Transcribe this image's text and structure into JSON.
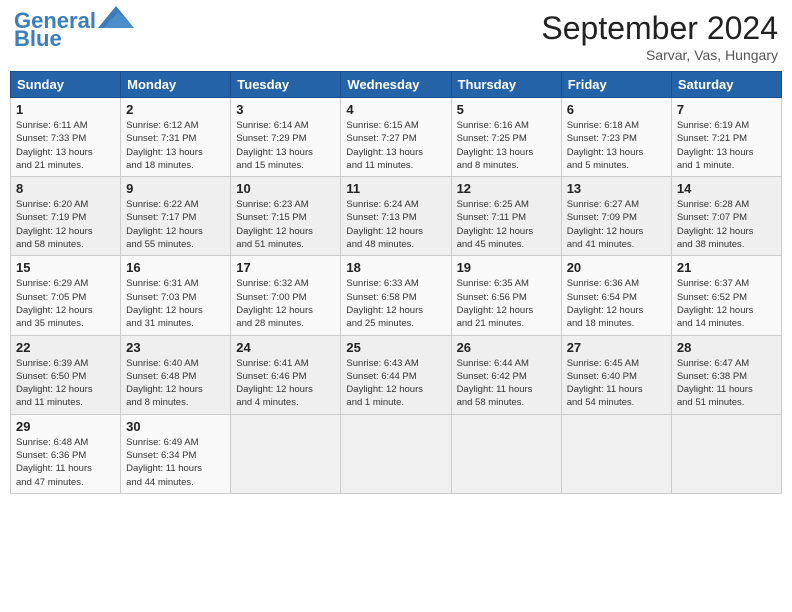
{
  "header": {
    "logo_line1": "General",
    "logo_line2": "Blue",
    "month": "September 2024",
    "location": "Sarvar, Vas, Hungary"
  },
  "days_of_week": [
    "Sunday",
    "Monday",
    "Tuesday",
    "Wednesday",
    "Thursday",
    "Friday",
    "Saturday"
  ],
  "weeks": [
    [
      {
        "day": "1",
        "info": "Sunrise: 6:11 AM\nSunset: 7:33 PM\nDaylight: 13 hours\nand 21 minutes."
      },
      {
        "day": "2",
        "info": "Sunrise: 6:12 AM\nSunset: 7:31 PM\nDaylight: 13 hours\nand 18 minutes."
      },
      {
        "day": "3",
        "info": "Sunrise: 6:14 AM\nSunset: 7:29 PM\nDaylight: 13 hours\nand 15 minutes."
      },
      {
        "day": "4",
        "info": "Sunrise: 6:15 AM\nSunset: 7:27 PM\nDaylight: 13 hours\nand 11 minutes."
      },
      {
        "day": "5",
        "info": "Sunrise: 6:16 AM\nSunset: 7:25 PM\nDaylight: 13 hours\nand 8 minutes."
      },
      {
        "day": "6",
        "info": "Sunrise: 6:18 AM\nSunset: 7:23 PM\nDaylight: 13 hours\nand 5 minutes."
      },
      {
        "day": "7",
        "info": "Sunrise: 6:19 AM\nSunset: 7:21 PM\nDaylight: 13 hours\nand 1 minute."
      }
    ],
    [
      {
        "day": "8",
        "info": "Sunrise: 6:20 AM\nSunset: 7:19 PM\nDaylight: 12 hours\nand 58 minutes."
      },
      {
        "day": "9",
        "info": "Sunrise: 6:22 AM\nSunset: 7:17 PM\nDaylight: 12 hours\nand 55 minutes."
      },
      {
        "day": "10",
        "info": "Sunrise: 6:23 AM\nSunset: 7:15 PM\nDaylight: 12 hours\nand 51 minutes."
      },
      {
        "day": "11",
        "info": "Sunrise: 6:24 AM\nSunset: 7:13 PM\nDaylight: 12 hours\nand 48 minutes."
      },
      {
        "day": "12",
        "info": "Sunrise: 6:25 AM\nSunset: 7:11 PM\nDaylight: 12 hours\nand 45 minutes."
      },
      {
        "day": "13",
        "info": "Sunrise: 6:27 AM\nSunset: 7:09 PM\nDaylight: 12 hours\nand 41 minutes."
      },
      {
        "day": "14",
        "info": "Sunrise: 6:28 AM\nSunset: 7:07 PM\nDaylight: 12 hours\nand 38 minutes."
      }
    ],
    [
      {
        "day": "15",
        "info": "Sunrise: 6:29 AM\nSunset: 7:05 PM\nDaylight: 12 hours\nand 35 minutes."
      },
      {
        "day": "16",
        "info": "Sunrise: 6:31 AM\nSunset: 7:03 PM\nDaylight: 12 hours\nand 31 minutes."
      },
      {
        "day": "17",
        "info": "Sunrise: 6:32 AM\nSunset: 7:00 PM\nDaylight: 12 hours\nand 28 minutes."
      },
      {
        "day": "18",
        "info": "Sunrise: 6:33 AM\nSunset: 6:58 PM\nDaylight: 12 hours\nand 25 minutes."
      },
      {
        "day": "19",
        "info": "Sunrise: 6:35 AM\nSunset: 6:56 PM\nDaylight: 12 hours\nand 21 minutes."
      },
      {
        "day": "20",
        "info": "Sunrise: 6:36 AM\nSunset: 6:54 PM\nDaylight: 12 hours\nand 18 minutes."
      },
      {
        "day": "21",
        "info": "Sunrise: 6:37 AM\nSunset: 6:52 PM\nDaylight: 12 hours\nand 14 minutes."
      }
    ],
    [
      {
        "day": "22",
        "info": "Sunrise: 6:39 AM\nSunset: 6:50 PM\nDaylight: 12 hours\nand 11 minutes."
      },
      {
        "day": "23",
        "info": "Sunrise: 6:40 AM\nSunset: 6:48 PM\nDaylight: 12 hours\nand 8 minutes."
      },
      {
        "day": "24",
        "info": "Sunrise: 6:41 AM\nSunset: 6:46 PM\nDaylight: 12 hours\nand 4 minutes."
      },
      {
        "day": "25",
        "info": "Sunrise: 6:43 AM\nSunset: 6:44 PM\nDaylight: 12 hours\nand 1 minute."
      },
      {
        "day": "26",
        "info": "Sunrise: 6:44 AM\nSunset: 6:42 PM\nDaylight: 11 hours\nand 58 minutes."
      },
      {
        "day": "27",
        "info": "Sunrise: 6:45 AM\nSunset: 6:40 PM\nDaylight: 11 hours\nand 54 minutes."
      },
      {
        "day": "28",
        "info": "Sunrise: 6:47 AM\nSunset: 6:38 PM\nDaylight: 11 hours\nand 51 minutes."
      }
    ],
    [
      {
        "day": "29",
        "info": "Sunrise: 6:48 AM\nSunset: 6:36 PM\nDaylight: 11 hours\nand 47 minutes."
      },
      {
        "day": "30",
        "info": "Sunrise: 6:49 AM\nSunset: 6:34 PM\nDaylight: 11 hours\nand 44 minutes."
      },
      {
        "day": "",
        "info": ""
      },
      {
        "day": "",
        "info": ""
      },
      {
        "day": "",
        "info": ""
      },
      {
        "day": "",
        "info": ""
      },
      {
        "day": "",
        "info": ""
      }
    ]
  ]
}
